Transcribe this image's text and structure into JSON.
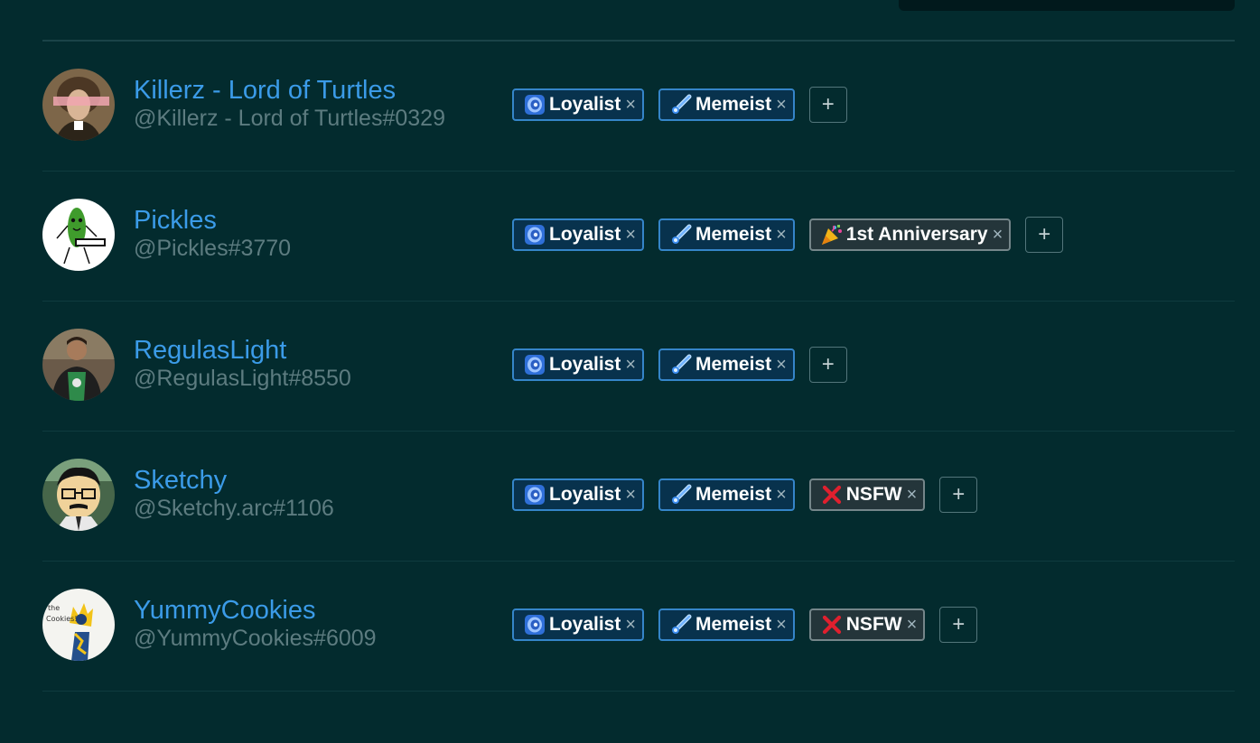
{
  "members": [
    {
      "display_name": "Killerz - Lord of Turtles",
      "handle": "@Killerz - Lord of Turtles#0329",
      "avatar": "portrait-avatar",
      "tags": [
        {
          "icon": "galaxy-icon",
          "label": "Loyalist",
          "style": "blue"
        },
        {
          "icon": "comet-icon",
          "label": "Memeist",
          "style": "blue"
        }
      ]
    },
    {
      "display_name": "Pickles",
      "handle": "@Pickles#3770",
      "avatar": "pickle-avatar",
      "tags": [
        {
          "icon": "galaxy-icon",
          "label": "Loyalist",
          "style": "blue"
        },
        {
          "icon": "comet-icon",
          "label": "Memeist",
          "style": "blue"
        },
        {
          "icon": "party-popper-icon",
          "label": "1st Anniversary",
          "style": "gray"
        }
      ]
    },
    {
      "display_name": "RegulasLight",
      "handle": "@RegulasLight#8550",
      "avatar": "photo-avatar",
      "tags": [
        {
          "icon": "galaxy-icon",
          "label": "Loyalist",
          "style": "blue"
        },
        {
          "icon": "comet-icon",
          "label": "Memeist",
          "style": "blue"
        }
      ]
    },
    {
      "display_name": "Sketchy",
      "handle": "@Sketchy.arc#1106",
      "avatar": "cartoon-avatar",
      "tags": [
        {
          "icon": "galaxy-icon",
          "label": "Loyalist",
          "style": "blue"
        },
        {
          "icon": "comet-icon",
          "label": "Memeist",
          "style": "blue"
        },
        {
          "icon": "red-cross-icon",
          "label": "NSFW",
          "style": "gray"
        }
      ]
    },
    {
      "display_name": "YummyCookies",
      "handle": "@YummyCookies#6009",
      "avatar": "cookie-drawing-avatar",
      "tags": [
        {
          "icon": "galaxy-icon",
          "label": "Loyalist",
          "style": "blue"
        },
        {
          "icon": "comet-icon",
          "label": "Memeist",
          "style": "blue"
        },
        {
          "icon": "red-cross-icon",
          "label": "NSFW",
          "style": "gray"
        }
      ]
    }
  ],
  "remove_symbol": "×",
  "add_symbol": "+",
  "colors": {
    "background": "#032b2e",
    "display_name": "#3b9be8",
    "handle": "#5d7c80",
    "tag_blue_border": "#3585c9",
    "tag_gray_border": "#75868a"
  }
}
